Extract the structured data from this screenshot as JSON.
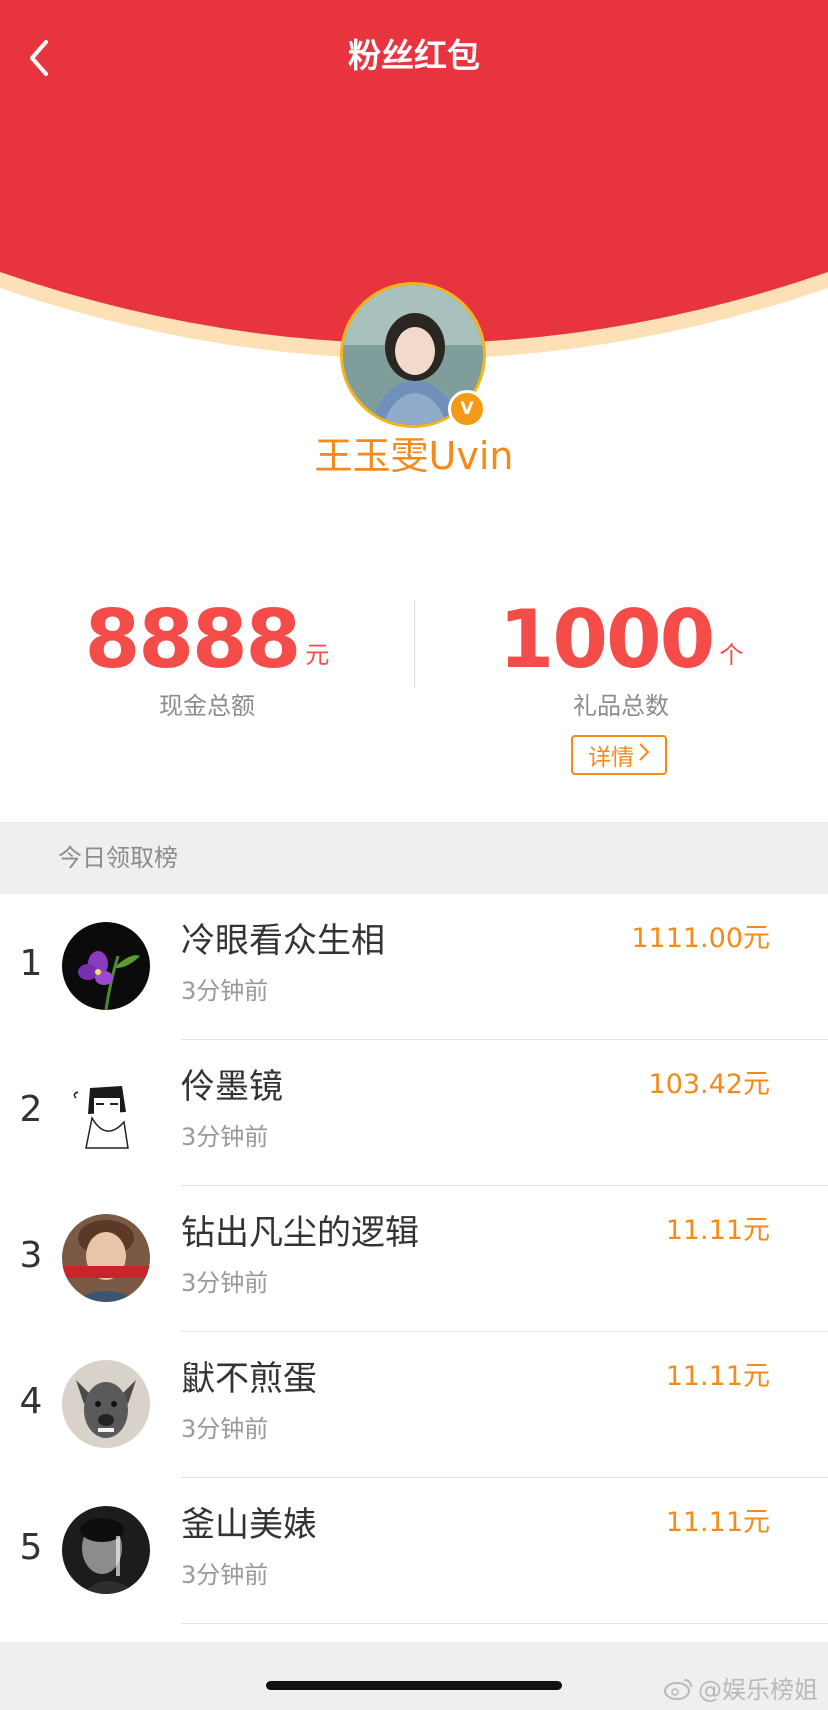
{
  "header": {
    "title": "粉丝红包",
    "back_icon": "chevron-left-icon",
    "background_color": "#e8343f",
    "arc_accent_color": "#fde0b6"
  },
  "profile": {
    "name": "王玉雯Uvin",
    "verified_badge": "V",
    "name_color": "#f58a18"
  },
  "stats": {
    "cash": {
      "value": "8888",
      "unit": "元",
      "label": "现金总额"
    },
    "gifts": {
      "value": "1000",
      "unit": "个",
      "label": "礼品总数"
    },
    "details_label": "详情",
    "value_color": "#f44c48"
  },
  "leaderboard": {
    "title": "今日领取榜",
    "rows": [
      {
        "rank": "1",
        "name": "冷眼看众生相",
        "time": "3分钟前",
        "amount": "1111.00元",
        "avatar": "purple-flower-avatar"
      },
      {
        "rank": "2",
        "name": "伶墨镜",
        "time": "3分钟前",
        "amount": "103.42元",
        "avatar": "cartoon-sketch-avatar"
      },
      {
        "rank": "3",
        "name": "钻出凡尘的逻辑",
        "time": "3分钟前",
        "amount": "11.11元",
        "avatar": "person-photo-avatar"
      },
      {
        "rank": "4",
        "name": "鼣不煎蛋",
        "time": "3分钟前",
        "amount": "11.11元",
        "avatar": "dog-photo-avatar"
      },
      {
        "rank": "5",
        "name": "釜山美婊",
        "time": "3分钟前",
        "amount": "11.11元",
        "avatar": "bw-portrait-avatar"
      }
    ],
    "amount_color": "#f58a18"
  },
  "watermark": {
    "text": "@娱乐榜姐",
    "icon": "weibo-logo-icon"
  }
}
